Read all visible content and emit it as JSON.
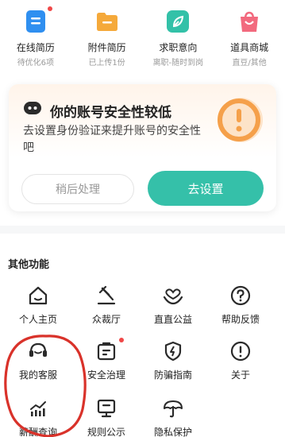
{
  "quick_row": [
    {
      "label": "在线简历",
      "sub": "待优化6项",
      "icon": "resume-icon",
      "color": "#2f8ff0",
      "dot": true
    },
    {
      "label": "附件简历",
      "sub": "已上传1份",
      "icon": "folder-icon",
      "color": "#f5a93a",
      "dot": false
    },
    {
      "label": "求职意向",
      "sub": "离职-随时到岗",
      "icon": "leaf-icon",
      "color": "#33c1a8",
      "dot": false
    },
    {
      "label": "道具商城",
      "sub": "直豆/其他",
      "icon": "shopping-bag-icon",
      "color": "#f26a7e",
      "dot": false
    }
  ],
  "security_card": {
    "title": "你的账号安全性较低",
    "desc": "去设置身份验证来提升账号的安全性吧",
    "later_label": "稍后处理",
    "set_label": "去设置",
    "accent": "#35c0a9",
    "warn_color": "#f5a04a"
  },
  "other_functions": {
    "title": "其他功能",
    "items": [
      {
        "label": "个人主页",
        "icon": "home-icon",
        "dot": false
      },
      {
        "label": "众裁厅",
        "icon": "gavel-icon",
        "dot": false
      },
      {
        "label": "直直公益",
        "icon": "heart-hands-icon",
        "dot": false
      },
      {
        "label": "帮助反馈",
        "icon": "question-icon",
        "dot": false
      },
      {
        "label": "我的客服",
        "icon": "customer-service-icon",
        "dot": false
      },
      {
        "label": "安全治理",
        "icon": "id-card-icon",
        "dot": true
      },
      {
        "label": "防骗指南",
        "icon": "shield-bolt-icon",
        "dot": false
      },
      {
        "label": "关于",
        "icon": "exclamation-icon",
        "dot": false
      },
      {
        "label": "薪酬查询",
        "icon": "salary-chart-icon",
        "dot": false
      },
      {
        "label": "规则公示",
        "icon": "rules-board-icon",
        "dot": false
      },
      {
        "label": "隐私保护",
        "icon": "umbrella-icon",
        "dot": false
      }
    ]
  }
}
